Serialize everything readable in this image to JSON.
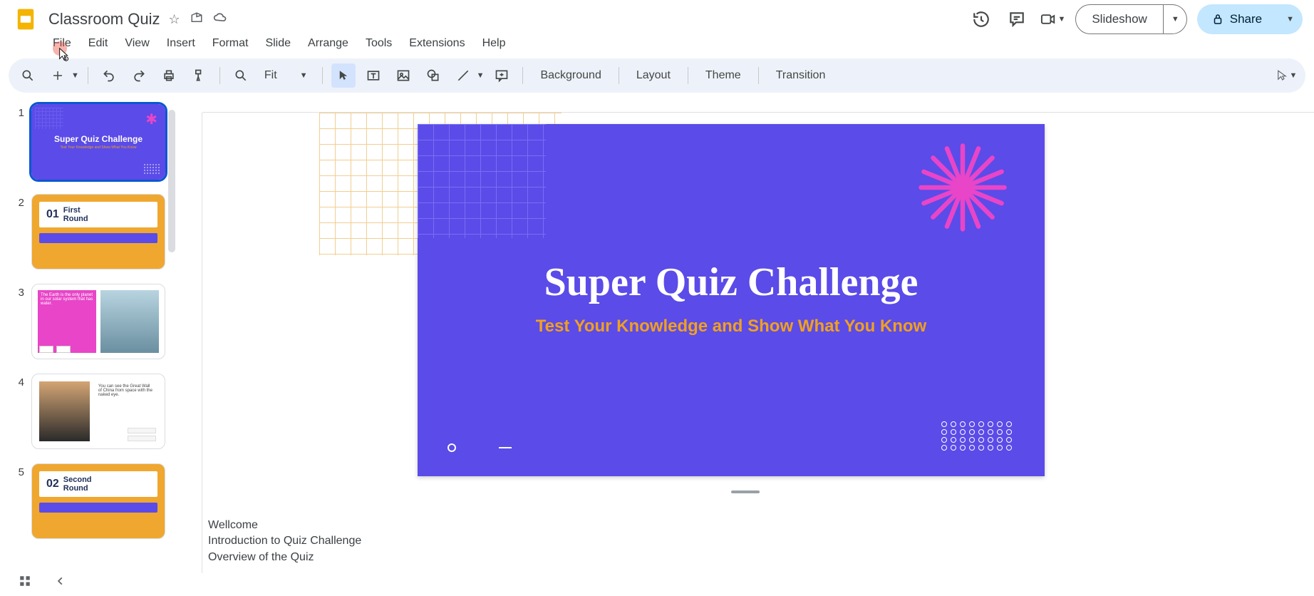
{
  "doc": {
    "title": "Classroom Quiz"
  },
  "menus": {
    "file": "File",
    "edit": "Edit",
    "view": "View",
    "insert": "Insert",
    "format": "Format",
    "slide": "Slide",
    "arrange": "Arrange",
    "tools": "Tools",
    "extensions": "Extensions",
    "help": "Help"
  },
  "header_buttons": {
    "slideshow": "Slideshow",
    "share": "Share"
  },
  "toolbar": {
    "zoom": "Fit",
    "background": "Background",
    "layout": "Layout",
    "theme": "Theme",
    "transition": "Transition"
  },
  "slide": {
    "title": "Super Quiz Challenge",
    "subtitle": "Test Your Knowledge and Show What You Know"
  },
  "thumbs": {
    "1": {
      "title": "Super Quiz Challenge",
      "sub": "Test Your Knowledge and Show What You Know"
    },
    "2": {
      "num": "01",
      "label_a": "First",
      "label_b": "Round"
    },
    "3": {
      "text": "The Earth is the only planet in our solar system that has water."
    },
    "4": {
      "text": "You can see the Great Wall of China from space with the naked eye."
    },
    "5": {
      "num": "02",
      "label_a": "Second",
      "label_b": "Round"
    }
  },
  "notes": {
    "line1": "Wellcome",
    "line2": "Introduction to Quiz Challenge",
    "line3": "Overview of the Quiz"
  },
  "nums": {
    "1": "1",
    "2": "2",
    "3": "3",
    "4": "4",
    "5": "5"
  }
}
